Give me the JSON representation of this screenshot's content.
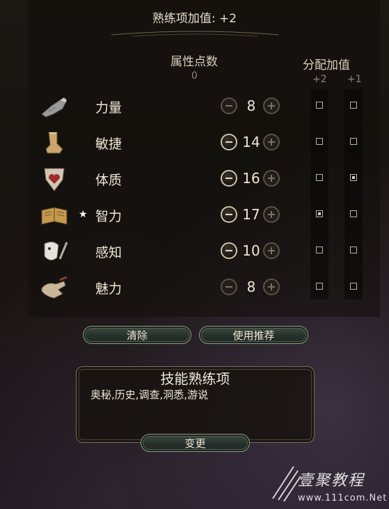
{
  "header": {
    "proficiency_bonus": "熟练项加值: +2"
  },
  "columns": {
    "points_label": "属性点数",
    "points_remaining": "0",
    "assign_label": "分配加值",
    "plus2": "+2",
    "plus1": "+1"
  },
  "attributes": [
    {
      "name": "力量",
      "value": "8",
      "icon": "gauntlet-icon",
      "starred": false,
      "minus_enabled": false,
      "plus2": false,
      "plus1": false
    },
    {
      "name": "敏捷",
      "value": "14",
      "icon": "boot-icon",
      "starred": false,
      "minus_enabled": true,
      "plus2": false,
      "plus1": false
    },
    {
      "name": "体质",
      "value": "16",
      "icon": "shield-heart-icon",
      "starred": false,
      "minus_enabled": true,
      "plus2": false,
      "plus1": true
    },
    {
      "name": "智力",
      "value": "17",
      "icon": "open-book-icon",
      "starred": true,
      "minus_enabled": true,
      "plus2": true,
      "plus1": false
    },
    {
      "name": "感知",
      "value": "10",
      "icon": "mask-feather-icon",
      "starred": false,
      "minus_enabled": true,
      "plus2": false,
      "plus1": false
    },
    {
      "name": "魅力",
      "value": "8",
      "icon": "hand-icon",
      "starred": false,
      "minus_enabled": false,
      "plus2": false,
      "plus1": false
    }
  ],
  "star_glyph": "★",
  "buttons": {
    "clear": "清除",
    "recommend": "使用推荐",
    "change": "变更"
  },
  "skills": {
    "title": "技能熟练项",
    "list": "奥秘,历史,调查,洞悉,游说"
  },
  "watermark": {
    "text": "壹聚教程",
    "url": "www.111com.Net"
  },
  "colors": {
    "text": "#efe6d6",
    "muted": "#8e857a",
    "button_green": "#2b3530"
  }
}
